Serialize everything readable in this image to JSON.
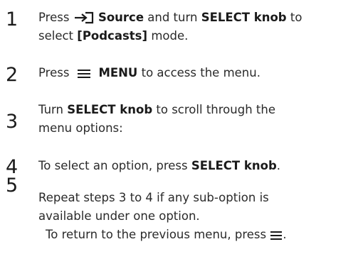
{
  "steps": [
    {
      "number": "1",
      "press": "Press",
      "source_icon": "source-input-icon",
      "source": "Source",
      "and_turn": "and turn",
      "select_knob": "SELECT knob",
      "to": "to",
      "select": "select",
      "podcasts": "[Podcasts]",
      "mode": "mode."
    },
    {
      "number": "2",
      "press": "Press",
      "menu_icon": "menu-icon",
      "menu": "MENU",
      "rest": "to access the menu."
    },
    {
      "number": "3",
      "turn": "Turn",
      "select_knob": "SELECT knob",
      "rest1": "to scroll through the",
      "rest2": "menu options:"
    },
    {
      "number": "4",
      "pre": "To select an option, press",
      "select_knob": "SELECT knob",
      "dot": "."
    },
    {
      "number": "5",
      "line1": "Repeat steps 3 to 4 if any sub-option is",
      "line2": "available under one option.",
      "line3": "To return to the previous menu, press",
      "menu_icon": "menu-icon",
      "dot": "."
    }
  ]
}
